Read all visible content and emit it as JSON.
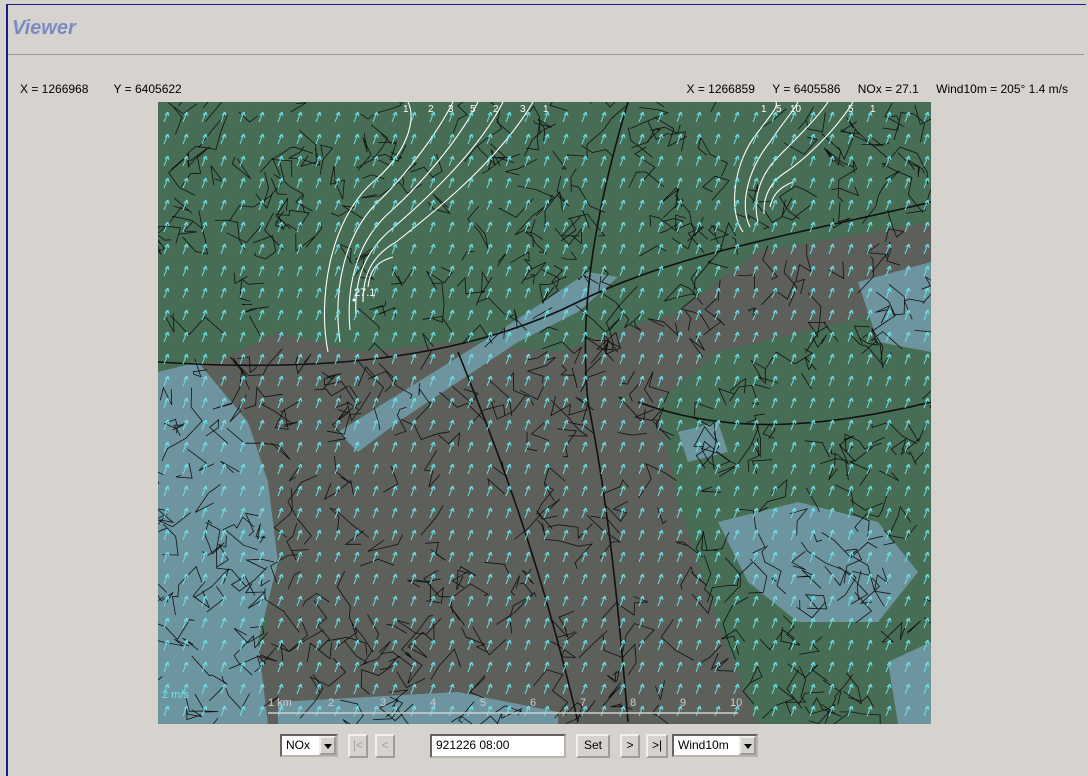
{
  "window": {
    "title": "Viewer"
  },
  "cursor_readout": {
    "x": "X = 1266968",
    "y": "Y = 6405622"
  },
  "probe_readout": {
    "x": "X = 1266859",
    "y": "Y = 6405586",
    "value": "NOx = 27.1",
    "wind": "Wind10m = 205° 1.4 m/s"
  },
  "map": {
    "peak_label": "27.1",
    "wind_scale_label": "2 m/s",
    "contour_labels_a": [
      "1",
      "2",
      "3",
      "5",
      "2",
      "3",
      "1"
    ],
    "contour_labels_b": [
      "1",
      "5",
      "10",
      "5",
      "1"
    ],
    "scalebar_labels": [
      "1 km",
      "2",
      "3",
      "4",
      "5",
      "6",
      "7",
      "8",
      "9",
      "10"
    ],
    "colors": {
      "land": "#5c5f5a",
      "vegetation": "#476d54",
      "water": "#6f98a3",
      "arrows": "#6fe0e8",
      "contours": "#ffffff"
    }
  },
  "controls": {
    "component_select": "NOx",
    "first_label": "|<",
    "prev_label": "<",
    "datetime_value": "921226 08:00",
    "set_label": "Set",
    "next_label": ">",
    "last_label": ">|",
    "overlay_select": "Wind10m"
  }
}
